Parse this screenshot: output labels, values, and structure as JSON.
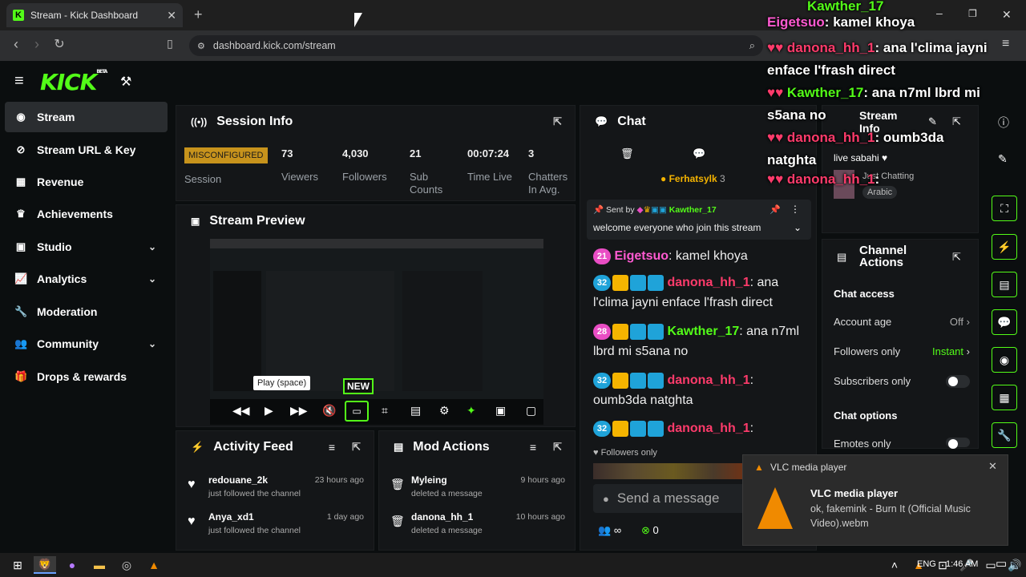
{
  "browser": {
    "tab_title": "Stream - Kick Dashboard",
    "url": "dashboard.kick.com/stream"
  },
  "logo": {
    "text": "KICK",
    "beta": "BETA"
  },
  "sidebar": {
    "items": [
      {
        "label": "Stream",
        "icon": "stream-icon"
      },
      {
        "label": "Stream URL & Key",
        "icon": "link-icon"
      },
      {
        "label": "Revenue",
        "icon": "revenue-icon"
      },
      {
        "label": "Achievements",
        "icon": "trophy-icon"
      },
      {
        "label": "Studio",
        "icon": "studio-icon"
      },
      {
        "label": "Analytics",
        "icon": "analytics-icon"
      },
      {
        "label": "Moderation",
        "icon": "wrench-icon"
      },
      {
        "label": "Community",
        "icon": "community-icon"
      },
      {
        "label": "Drops & rewards",
        "icon": "gift-icon"
      }
    ]
  },
  "session": {
    "title": "Session Info",
    "badge": "MISCONFIGURED",
    "badge_label": "Session",
    "stats": [
      {
        "value": "73",
        "label": "Viewers"
      },
      {
        "value": "4,030",
        "label": "Followers"
      },
      {
        "value": "21",
        "label": "Sub Counts"
      },
      {
        "value": "00:07:24",
        "label": "Time Live"
      },
      {
        "value": "3",
        "label": "Chatters In Avg."
      }
    ]
  },
  "preview": {
    "title": "Stream Preview",
    "tooltip": "Play (space)",
    "new_badge": "NEW"
  },
  "activity": {
    "title": "Activity Feed",
    "items": [
      {
        "user": "redouane_2k",
        "action": "just followed the channel",
        "time": "23 hours ago"
      },
      {
        "user": "Anya_xd1",
        "action": "just followed the channel",
        "time": "1 day ago"
      }
    ]
  },
  "mod": {
    "title": "Mod Actions",
    "items": [
      {
        "user": "Myleing",
        "action": "deleted a message",
        "time": "9 hours ago"
      },
      {
        "user": "danona_hh_1",
        "action": "deleted a message",
        "time": "10 hours ago"
      }
    ]
  },
  "chat": {
    "title": "Chat",
    "top_user": "Ferhatsylk",
    "top_count": "3",
    "pinned_by": "Sent by",
    "pinned_user": "Kawther_17",
    "pinned_text": "welcome everyone who join this stream",
    "messages": [
      {
        "badge": "21",
        "badge_color": "#e94dc4",
        "user": "Eigetsuo",
        "color": "#ff5ad1",
        "text": "kamel khoya",
        "icons": false
      },
      {
        "badge": "32",
        "badge_color": "#1fa3d9",
        "user": "danona_hh_1",
        "color": "#ff3b6b",
        "text": "ana l'clima jayni enface l'frash direct",
        "icons": true
      },
      {
        "badge": "28",
        "badge_color": "#e94dc4",
        "user": "Kawther_17",
        "color": "#53fc18",
        "text": "ana n7ml lbrd mi s5ana no",
        "icons": true
      },
      {
        "badge": "32",
        "badge_color": "#1fa3d9",
        "user": "danona_hh_1",
        "color": "#ff3b6b",
        "text": "oumb3da natghta",
        "icons": true
      },
      {
        "badge": "32",
        "badge_color": "#1fa3d9",
        "user": "danona_hh_1",
        "color": "#ff3b6b",
        "text": "",
        "icons": true
      }
    ],
    "followers_only": "Followers only",
    "placeholder": "Send a message",
    "infinity": "∞",
    "points": "0"
  },
  "stream_info": {
    "title": "Stream Info",
    "line": "live sabahi ♥",
    "category": "Just Chatting",
    "tag": "Arabic"
  },
  "channel_actions": {
    "title": "Channel Actions",
    "chat_access": "Chat access",
    "account_age": "Account age",
    "account_age_value": "Off",
    "followers_only": "Followers only",
    "followers_value": "Instant",
    "subscribers_only": "Subscribers only",
    "chat_options": "Chat options",
    "emotes_only": "Emotes only"
  },
  "overlay": [
    {
      "user": "Kawther_17",
      "text": ""
    },
    {
      "user": "Eigetsuo",
      "text": "kamel khoya"
    },
    {
      "user": "danona_hh_1",
      "text": "ana l'clima jayni enface l'frash direct"
    },
    {
      "user": "Kawther_17",
      "text": "ana n7ml lbrd mi s5ana no"
    },
    {
      "user": "danona_hh_1",
      "text": "oumb3da natghta"
    },
    {
      "user": "danona_hh_1",
      "text": ""
    }
  ],
  "vlc": {
    "header": "VLC media player",
    "title": "VLC media player",
    "body": "ok, fakemink - Burn It (Official Music Video).webm"
  },
  "taskbar": {
    "lang": "ENG",
    "time": "1:46 AM"
  }
}
